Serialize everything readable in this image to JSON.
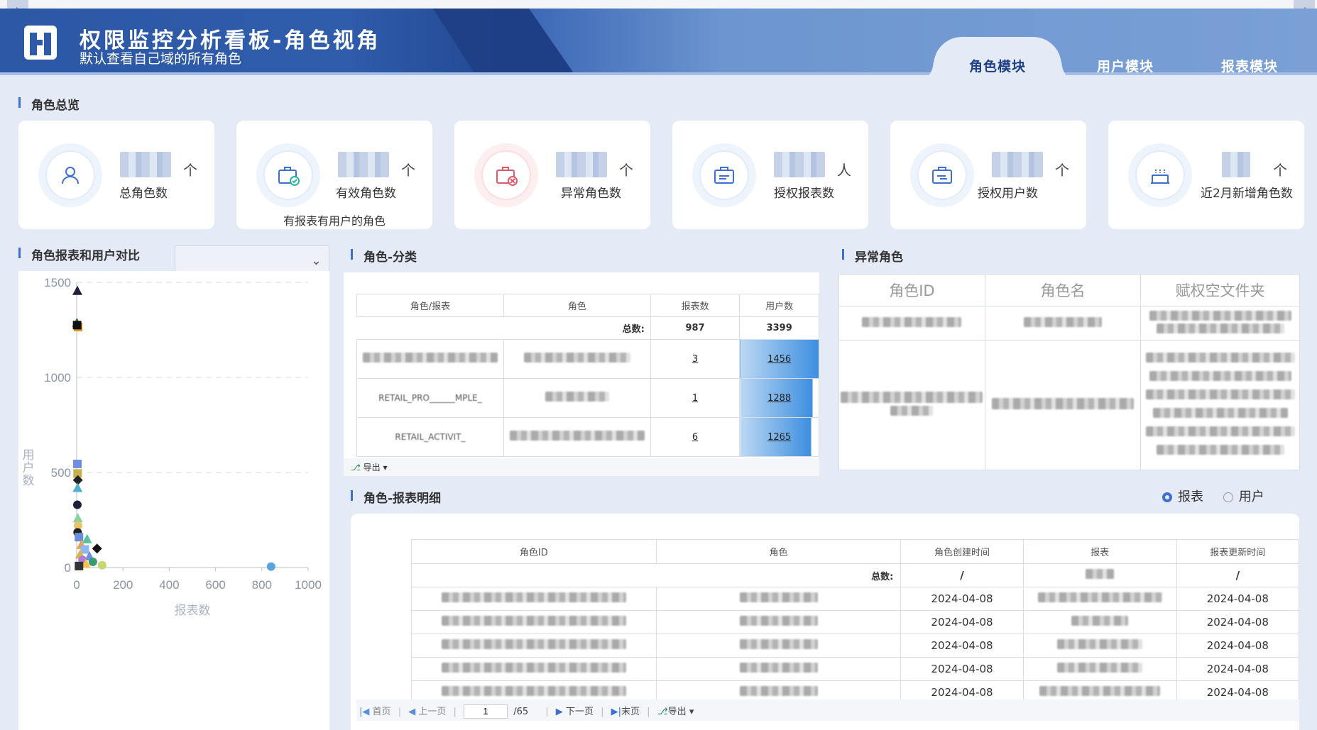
{
  "header": {
    "title": "权限监控分析看板-角色视角",
    "subtitle": "默认查看自己域的所有角色",
    "tabs": [
      {
        "label": "角色模块",
        "active": true
      },
      {
        "label": "用户模块",
        "active": false
      },
      {
        "label": "报表模块",
        "active": false
      }
    ],
    "corner_left": "›",
    "corner_right": "‹"
  },
  "overview": {
    "title": "角色总览",
    "cards": [
      {
        "label": "总角色数",
        "unit": "个",
        "icon": "user-icon",
        "sub": ""
      },
      {
        "label": "有效角色数",
        "unit": "个",
        "icon": "briefcase-check-icon",
        "sub": "有报表有用户的角色"
      },
      {
        "label": "异常角色数",
        "unit": "个",
        "icon": "briefcase-x-icon",
        "sub": ""
      },
      {
        "label": "授权报表数",
        "unit": "人",
        "icon": "briefcase-report-icon",
        "sub": ""
      },
      {
        "label": "授权用户数",
        "unit": "个",
        "icon": "briefcase-user-icon",
        "sub": ""
      },
      {
        "label": "近2月新增角色数",
        "unit": "个",
        "icon": "cake-icon",
        "sub": ""
      }
    ]
  },
  "compare": {
    "title": "角色报表和用户对比",
    "select_value": ""
  },
  "chart_data": {
    "type": "scatter",
    "title": "角色报表和用户对比",
    "xlabel": "报表数",
    "ylabel": "用户数",
    "xlim": [
      0,
      1000
    ],
    "ylim": [
      0,
      1500
    ],
    "x_ticks": [
      "0",
      "200",
      "400",
      "600",
      "800",
      "1000"
    ],
    "y_ticks": [
      "0",
      "500",
      "1000",
      "1500"
    ],
    "grid": true,
    "points": [
      {
        "x": 3,
        "y": 1456,
        "shape": "triangle",
        "color": "#1f1f3a"
      },
      {
        "x": 1,
        "y": 1288,
        "shape": "triangle",
        "color": "#2a7a3c"
      },
      {
        "x": 6,
        "y": 1265,
        "shape": "square",
        "color": "#d69a18"
      },
      {
        "x": 2,
        "y": 1275,
        "shape": "square",
        "color": "#111111"
      },
      {
        "x": 3,
        "y": 545,
        "shape": "square",
        "color": "#6f8ee0"
      },
      {
        "x": 4,
        "y": 495,
        "shape": "square",
        "color": "#c8b04a"
      },
      {
        "x": 5,
        "y": 460,
        "shape": "diamond",
        "color": "#222222"
      },
      {
        "x": 4,
        "y": 420,
        "shape": "triangle",
        "color": "#50b0d0"
      },
      {
        "x": 3,
        "y": 330,
        "shape": "circle",
        "color": "#1f1f3a"
      },
      {
        "x": 5,
        "y": 260,
        "shape": "triangle",
        "color": "#8bd0a0"
      },
      {
        "x": 6,
        "y": 220,
        "shape": "circle",
        "color": "#e9c46a"
      },
      {
        "x": 4,
        "y": 185,
        "shape": "circle",
        "color": "#222222"
      },
      {
        "x": 10,
        "y": 160,
        "shape": "square",
        "color": "#6a8fd8"
      },
      {
        "x": 45,
        "y": 150,
        "shape": "triangle",
        "color": "#54c2a0"
      },
      {
        "x": 88,
        "y": 100,
        "shape": "diamond",
        "color": "#111111"
      },
      {
        "x": 20,
        "y": 120,
        "shape": "triangle",
        "color": "#f0a050"
      },
      {
        "x": 35,
        "y": 95,
        "shape": "square",
        "color": "#8fb7f0"
      },
      {
        "x": 15,
        "y": 70,
        "shape": "triangle",
        "color": "#d9b64a"
      },
      {
        "x": 55,
        "y": 60,
        "shape": "triangle",
        "color": "#6f8ee0"
      },
      {
        "x": 25,
        "y": 40,
        "shape": "circle",
        "color": "#b07cd8"
      },
      {
        "x": 70,
        "y": 30,
        "shape": "circle",
        "color": "#3a9a70"
      },
      {
        "x": 40,
        "y": 20,
        "shape": "triangle",
        "color": "#f2c14e"
      },
      {
        "x": 110,
        "y": 12,
        "shape": "circle",
        "color": "#c5d86d"
      },
      {
        "x": 10,
        "y": 8,
        "shape": "square",
        "color": "#333333"
      },
      {
        "x": 840,
        "y": 5,
        "shape": "circle",
        "color": "#5ba3e0"
      }
    ]
  },
  "category": {
    "title": "角色-分类",
    "columns": [
      "角色/报表",
      "角色",
      "报表数",
      "用户数"
    ],
    "total_label": "总数:",
    "total_reports": "987",
    "total_users": "3399",
    "rows": [
      {
        "reports": "3",
        "users": "1456",
        "fill": 1.0
      },
      {
        "reports": "1",
        "users": "1288",
        "fill": 0.92
      },
      {
        "reports": "6",
        "users": "1265",
        "fill": 0.9
      }
    ],
    "row2_fragment": "RETAIL_PRO______MPLE_",
    "row3_fragment": "RETAIL_ACTIVIT_",
    "export_label": "导出"
  },
  "abnormal": {
    "title": "异常角色",
    "columns": [
      "角色ID",
      "角色名",
      "赋权空文件夹"
    ]
  },
  "detail": {
    "title": "角色-报表明细",
    "radio_report": "报表",
    "radio_user": "用户",
    "columns": [
      "角色ID",
      "角色",
      "角色创建时间",
      "报表",
      "报表更新时间"
    ],
    "total_label": "总数:",
    "total_created": "/",
    "total_updated": "/",
    "rows": [
      {
        "created": "2024-04-08",
        "updated": "2024-04-08"
      },
      {
        "created": "2024-04-08",
        "updated": "2024-04-08"
      },
      {
        "created": "2024-04-08",
        "updated": "2024-04-08"
      },
      {
        "created": "2024-04-08",
        "updated": "2024-04-08"
      },
      {
        "created": "2024-04-08",
        "updated": "2024-04-08"
      }
    ],
    "pager": {
      "first": "首页",
      "prev": "上一页",
      "page": "1",
      "total": "/65",
      "next": "下一页",
      "last": "末页",
      "export": "导出"
    }
  }
}
